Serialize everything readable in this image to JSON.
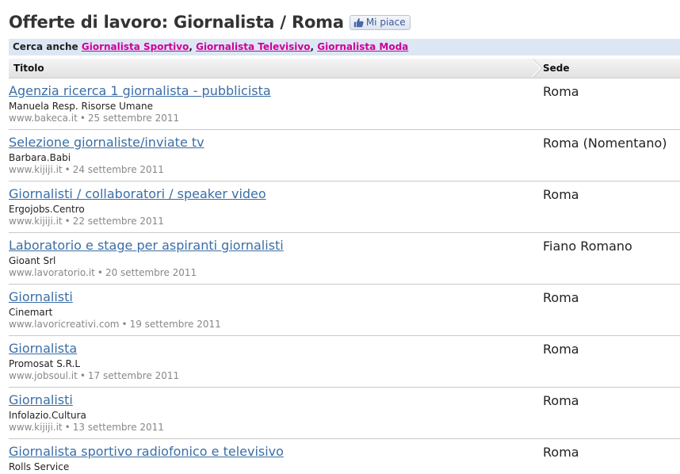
{
  "header": {
    "title": "Offerte di lavoro: Giornalista / Roma",
    "like_label": "Mi piace"
  },
  "search_also": {
    "prefix": "Cerca anche",
    "links": [
      "Giornalista Sportivo",
      "Giornalista Televisivo",
      "Giornalista Moda"
    ],
    "separator": ","
  },
  "table": {
    "col_title": "Titolo",
    "col_location": "Sede",
    "date_separator": "•"
  },
  "jobs": [
    {
      "title": "Agenzia ricerca 1 giornalista - pubblicista",
      "company": "Manuela Resp. Risorse Umane",
      "source": "www.bakeca.it",
      "date": "25 settembre 2011",
      "location": "Roma"
    },
    {
      "title": "Selezione giornaliste/inviate tv",
      "company": "Barbara.Babi",
      "source": "www.kijiji.it",
      "date": "24 settembre 2011",
      "location": "Roma (Nomentano)"
    },
    {
      "title": "Giornalisti / collaboratori / speaker video",
      "company": "Ergojobs.Centro",
      "source": "www.kijiji.it",
      "date": "22 settembre 2011",
      "location": "Roma"
    },
    {
      "title": "Laboratorio e stage per aspiranti giornalisti",
      "company": "Gioant Srl",
      "source": "www.lavoratorio.it",
      "date": "20 settembre 2011",
      "location": "Fiano Romano"
    },
    {
      "title": "Giornalisti",
      "company": "Cinemart",
      "source": "www.lavoricreativi.com",
      "date": "19 settembre 2011",
      "location": "Roma"
    },
    {
      "title": "Giornalista",
      "company": "Promosat S.R.L",
      "source": "www.jobsoul.it",
      "date": "17 settembre 2011",
      "location": "Roma"
    },
    {
      "title": "Giornalisti",
      "company": "Infolazio.Cultura",
      "source": "www.kijiji.it",
      "date": "13 settembre 2011",
      "location": "Roma"
    },
    {
      "title": "Giornalista sportivo radiofonico e televisivo",
      "company": "Rolls Service",
      "source": "",
      "date": "",
      "location": "Roma"
    }
  ],
  "colors": {
    "link": "#3b6ea5",
    "also_link": "#cc0099",
    "also_bar_bg": "#dde7f4",
    "meta_text": "#888888"
  }
}
